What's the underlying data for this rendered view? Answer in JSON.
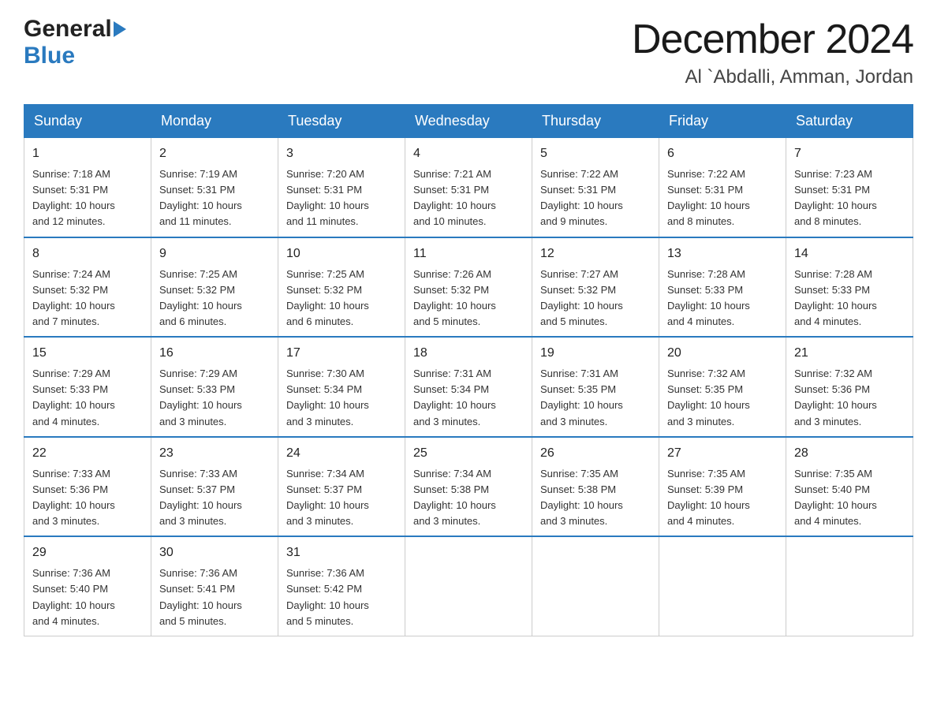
{
  "header": {
    "logo_general": "General",
    "logo_blue": "Blue",
    "month_title": "December 2024",
    "location": "Al `Abdalli, Amman, Jordan"
  },
  "days_of_week": [
    "Sunday",
    "Monday",
    "Tuesday",
    "Wednesday",
    "Thursday",
    "Friday",
    "Saturday"
  ],
  "weeks": [
    [
      {
        "day": "1",
        "sunrise": "7:18 AM",
        "sunset": "5:31 PM",
        "daylight": "10 hours and 12 minutes."
      },
      {
        "day": "2",
        "sunrise": "7:19 AM",
        "sunset": "5:31 PM",
        "daylight": "10 hours and 11 minutes."
      },
      {
        "day": "3",
        "sunrise": "7:20 AM",
        "sunset": "5:31 PM",
        "daylight": "10 hours and 11 minutes."
      },
      {
        "day": "4",
        "sunrise": "7:21 AM",
        "sunset": "5:31 PM",
        "daylight": "10 hours and 10 minutes."
      },
      {
        "day": "5",
        "sunrise": "7:22 AM",
        "sunset": "5:31 PM",
        "daylight": "10 hours and 9 minutes."
      },
      {
        "day": "6",
        "sunrise": "7:22 AM",
        "sunset": "5:31 PM",
        "daylight": "10 hours and 8 minutes."
      },
      {
        "day": "7",
        "sunrise": "7:23 AM",
        "sunset": "5:31 PM",
        "daylight": "10 hours and 8 minutes."
      }
    ],
    [
      {
        "day": "8",
        "sunrise": "7:24 AM",
        "sunset": "5:32 PM",
        "daylight": "10 hours and 7 minutes."
      },
      {
        "day": "9",
        "sunrise": "7:25 AM",
        "sunset": "5:32 PM",
        "daylight": "10 hours and 6 minutes."
      },
      {
        "day": "10",
        "sunrise": "7:25 AM",
        "sunset": "5:32 PM",
        "daylight": "10 hours and 6 minutes."
      },
      {
        "day": "11",
        "sunrise": "7:26 AM",
        "sunset": "5:32 PM",
        "daylight": "10 hours and 5 minutes."
      },
      {
        "day": "12",
        "sunrise": "7:27 AM",
        "sunset": "5:32 PM",
        "daylight": "10 hours and 5 minutes."
      },
      {
        "day": "13",
        "sunrise": "7:28 AM",
        "sunset": "5:33 PM",
        "daylight": "10 hours and 4 minutes."
      },
      {
        "day": "14",
        "sunrise": "7:28 AM",
        "sunset": "5:33 PM",
        "daylight": "10 hours and 4 minutes."
      }
    ],
    [
      {
        "day": "15",
        "sunrise": "7:29 AM",
        "sunset": "5:33 PM",
        "daylight": "10 hours and 4 minutes."
      },
      {
        "day": "16",
        "sunrise": "7:29 AM",
        "sunset": "5:33 PM",
        "daylight": "10 hours and 3 minutes."
      },
      {
        "day": "17",
        "sunrise": "7:30 AM",
        "sunset": "5:34 PM",
        "daylight": "10 hours and 3 minutes."
      },
      {
        "day": "18",
        "sunrise": "7:31 AM",
        "sunset": "5:34 PM",
        "daylight": "10 hours and 3 minutes."
      },
      {
        "day": "19",
        "sunrise": "7:31 AM",
        "sunset": "5:35 PM",
        "daylight": "10 hours and 3 minutes."
      },
      {
        "day": "20",
        "sunrise": "7:32 AM",
        "sunset": "5:35 PM",
        "daylight": "10 hours and 3 minutes."
      },
      {
        "day": "21",
        "sunrise": "7:32 AM",
        "sunset": "5:36 PM",
        "daylight": "10 hours and 3 minutes."
      }
    ],
    [
      {
        "day": "22",
        "sunrise": "7:33 AM",
        "sunset": "5:36 PM",
        "daylight": "10 hours and 3 minutes."
      },
      {
        "day": "23",
        "sunrise": "7:33 AM",
        "sunset": "5:37 PM",
        "daylight": "10 hours and 3 minutes."
      },
      {
        "day": "24",
        "sunrise": "7:34 AM",
        "sunset": "5:37 PM",
        "daylight": "10 hours and 3 minutes."
      },
      {
        "day": "25",
        "sunrise": "7:34 AM",
        "sunset": "5:38 PM",
        "daylight": "10 hours and 3 minutes."
      },
      {
        "day": "26",
        "sunrise": "7:35 AM",
        "sunset": "5:38 PM",
        "daylight": "10 hours and 3 minutes."
      },
      {
        "day": "27",
        "sunrise": "7:35 AM",
        "sunset": "5:39 PM",
        "daylight": "10 hours and 4 minutes."
      },
      {
        "day": "28",
        "sunrise": "7:35 AM",
        "sunset": "5:40 PM",
        "daylight": "10 hours and 4 minutes."
      }
    ],
    [
      {
        "day": "29",
        "sunrise": "7:36 AM",
        "sunset": "5:40 PM",
        "daylight": "10 hours and 4 minutes."
      },
      {
        "day": "30",
        "sunrise": "7:36 AM",
        "sunset": "5:41 PM",
        "daylight": "10 hours and 5 minutes."
      },
      {
        "day": "31",
        "sunrise": "7:36 AM",
        "sunset": "5:42 PM",
        "daylight": "10 hours and 5 minutes."
      },
      null,
      null,
      null,
      null
    ]
  ],
  "labels": {
    "sunrise": "Sunrise:",
    "sunset": "Sunset:",
    "daylight": "Daylight:"
  }
}
